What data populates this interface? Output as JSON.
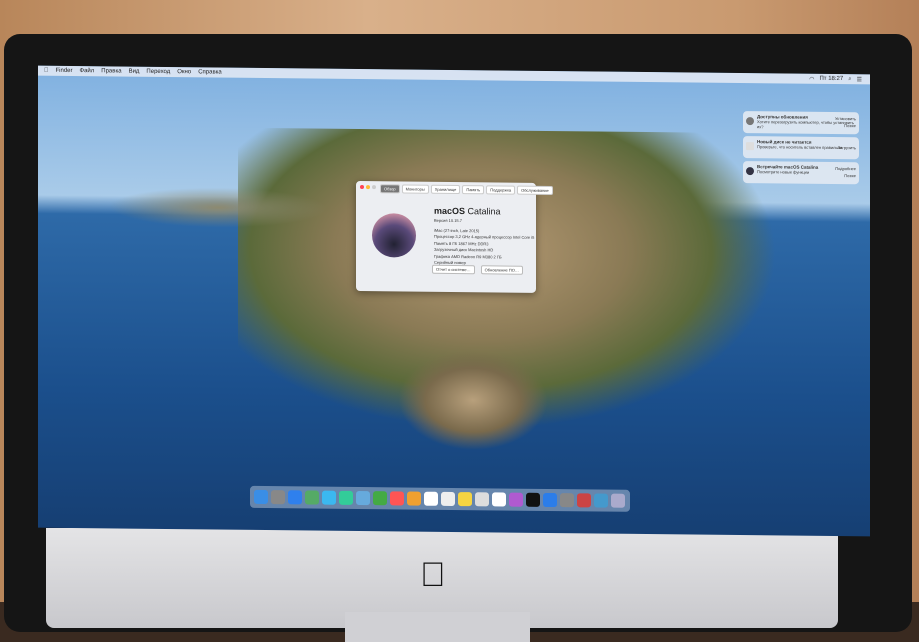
{
  "menubar": {
    "apple": "",
    "items": [
      "Finder",
      "Файл",
      "Правка",
      "Вид",
      "Переход",
      "Окно",
      "Справка"
    ],
    "clock": "Пт 18:27"
  },
  "about": {
    "tabs": [
      "Обзор",
      "Мониторы",
      "Хранилище",
      "Память",
      "Поддержка",
      "Обслуживание"
    ],
    "title_bold": "macOS",
    "title": " Catalina",
    "version": "Версия 10.15.7",
    "lines": [
      "iMac (27-inch, Late 2015)",
      "Процессор  3,2 GHz 4-ядерный процессор Intel Core i5",
      "Память  8 ГБ 1867 MHz DDR3",
      "Загрузочный диск  Macintosh HD",
      "Графика  AMD Radeon R9 M380 2 ГБ",
      "Серийный номер"
    ],
    "buttons": [
      "Отчет о системе…",
      "Обновление ПО…"
    ]
  },
  "notifications": [
    {
      "title": "Доступны обновления",
      "body": "Хотите перезагрузить компьютер, чтобы установить их?",
      "actions": [
        "Установить",
        "Позже"
      ]
    },
    {
      "title": "Новый диск не читается",
      "body": "Проверьте, что носитель вставлен правильно",
      "actions": [
        "Загрузить"
      ]
    },
    {
      "title": "Встречайте macOS Catalina",
      "body": "Посмотрите новые функции",
      "actions": [
        "Подробнее",
        "Позже"
      ]
    }
  ],
  "dock": {
    "colors": [
      "#3a8ee6",
      "#888",
      "#2f80ed",
      "#5a6",
      "#3bb8f0",
      "#3c9",
      "#6ad",
      "#4a4",
      "#f55",
      "#f0a030",
      "#fff",
      "#eee",
      "#f5d442",
      "#ddd",
      "#fff",
      "#b05ad0",
      "#111",
      "#2b7de9",
      "#888",
      "#c44",
      "#49c",
      "#aac"
    ]
  }
}
